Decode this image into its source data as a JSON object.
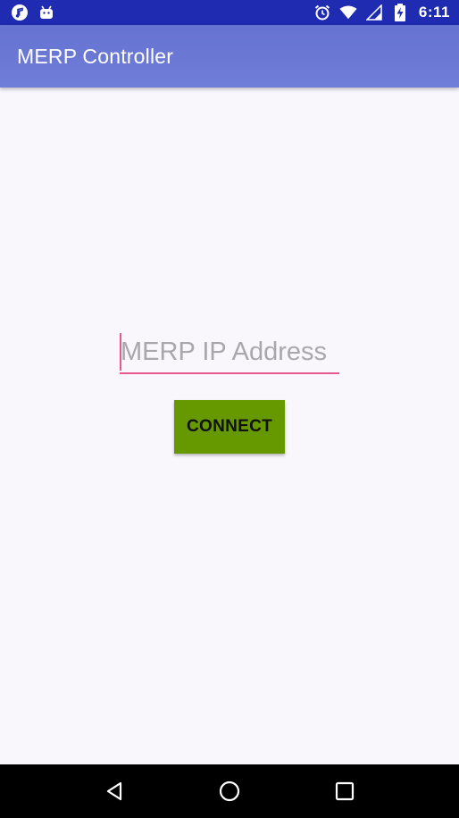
{
  "status_bar": {
    "time": "6:11",
    "left_icons": [
      "music-note-icon",
      "android-icon"
    ],
    "right_icons": [
      "alarm-icon",
      "wifi-icon",
      "cell-signal-icon",
      "battery-charging-icon"
    ],
    "background_color": "#1f2bb0"
  },
  "app_bar": {
    "title": "MERP Controller",
    "background_color": "#6f7ed8"
  },
  "form": {
    "ip_placeholder": "MERP IP Address",
    "ip_value": "",
    "connect_label": "CONNECT",
    "accent_color": "#e8578d",
    "button_color": "#669900"
  },
  "nav_bar": {
    "buttons": [
      "back-icon",
      "home-icon",
      "recents-icon"
    ]
  }
}
